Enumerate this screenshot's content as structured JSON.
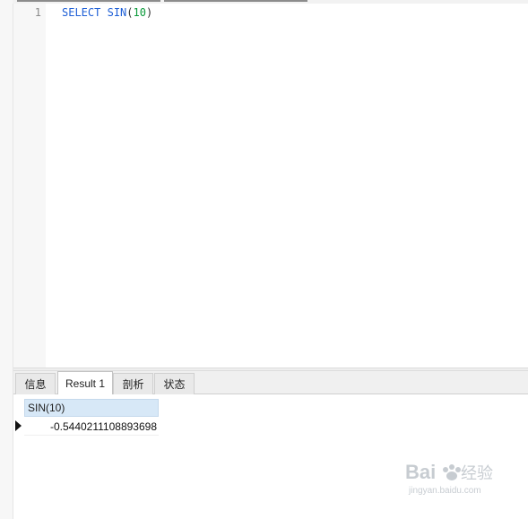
{
  "editor": {
    "lines": [
      {
        "number": "1",
        "tokens": {
          "keyword": "SELECT",
          "function": "SIN",
          "open_paren": "(",
          "argument": "10",
          "close_paren": ")"
        }
      }
    ]
  },
  "result_tabs": [
    {
      "label": "信息",
      "active": false
    },
    {
      "label": "Result 1",
      "active": true
    },
    {
      "label": "剖析",
      "active": false
    },
    {
      "label": "状态",
      "active": false
    }
  ],
  "result_grid": {
    "columns": [
      "SIN(10)"
    ],
    "rows": [
      [
        "-0.5440211108893698"
      ]
    ]
  },
  "watermark": {
    "brand": "Baidu经验",
    "url": "jingyan.baidu.com"
  },
  "colors": {
    "keyword": "#1e5fd6",
    "number": "#0a9a3a",
    "header_bg": "#d7e8f7"
  }
}
